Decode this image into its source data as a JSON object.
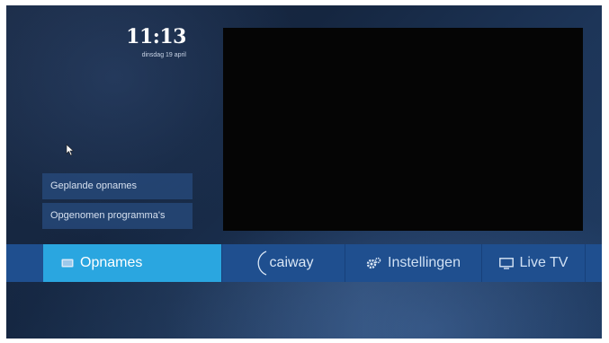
{
  "clock": {
    "time": "11:13",
    "date": "dinsdag 19 april"
  },
  "submenu": {
    "items": [
      {
        "label": "Geplande opnames"
      },
      {
        "label": "Opgenomen programma's"
      }
    ]
  },
  "navbar": {
    "items": [
      {
        "label": "Opnames",
        "icon": "recording-icon",
        "active": true
      },
      {
        "label": "caiway",
        "icon": "caiway-logo"
      },
      {
        "label": "Instellingen",
        "icon": "gear-icon"
      },
      {
        "label": "Live TV",
        "icon": "tv-icon"
      }
    ]
  },
  "colors": {
    "accent": "#2aa6e0",
    "navbar": "#1f4f8f",
    "background": "#1a2a44",
    "preview": "#050505"
  }
}
